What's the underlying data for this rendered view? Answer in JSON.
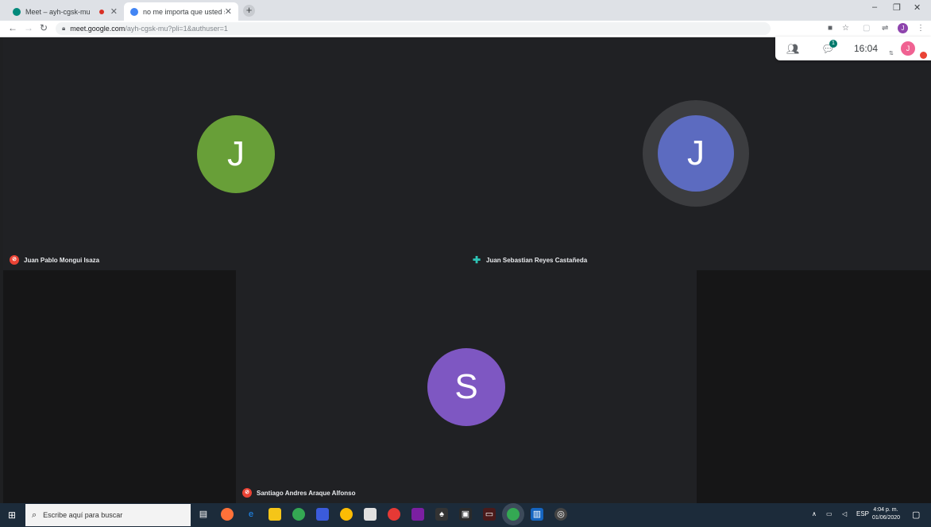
{
  "browser": {
    "tabs": [
      {
        "title": "Meet – ayh-cgsk-mu",
        "favicon_color": "#00897b"
      },
      {
        "title": "no me importa que usted sea m",
        "favicon_color": "#4285f4"
      }
    ],
    "new_tab": "+",
    "window_controls": [
      "–",
      "❐",
      "✕"
    ],
    "url_host": "meet.google.com",
    "url_path": "/ayh-cgsk-mu?pli=1&authuser=1"
  },
  "meet": {
    "participants": [
      {
        "initial": "J",
        "name": "Juan Pablo Mongui Isaza",
        "color": "#689f38",
        "muted": true
      },
      {
        "initial": "J",
        "name": "Juan Sebastian Reyes Castañeda",
        "color": "#5c6bc0",
        "muted": false,
        "speaking": true
      },
      {
        "initial": "S",
        "name": "Santiago Andres Araque Alfonso",
        "color": "#7e57c2",
        "muted": true
      }
    ],
    "card": {
      "chat_badge": "1",
      "time": "16:04",
      "self_initial": "J"
    }
  },
  "taskbar": {
    "search_placeholder": "Escribe aquí para buscar",
    "lang": "ESP",
    "time": "4:04 p. m.",
    "date": "01/06/2020"
  }
}
